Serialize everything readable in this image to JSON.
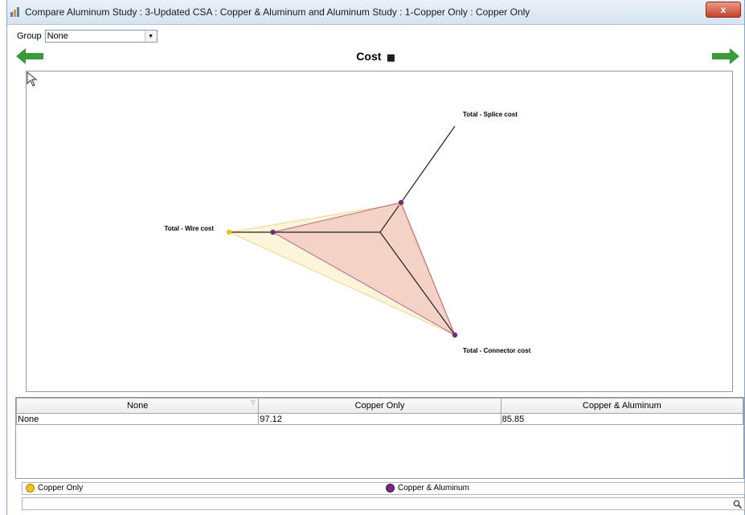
{
  "window": {
    "title": "Compare Aluminum Study : 3-Updated CSA : Copper & Aluminum and Aluminum Study : 1-Copper Only : Copper Only",
    "close_label": "x"
  },
  "group": {
    "label": "Group",
    "value": "None"
  },
  "chart": {
    "title": "Cost"
  },
  "chart_data": {
    "type": "radar",
    "title": "Cost",
    "axes": [
      "Total - Splice cost",
      "Total - Connector cost",
      "Total - Wire cost"
    ],
    "series": [
      {
        "name": "Copper Only",
        "color": "#f0c020",
        "values": [
          0.27,
          1.0,
          1.0
        ]
      },
      {
        "name": "Copper & Aluminum",
        "color": "#7b2a7b",
        "values": [
          0.28,
          1.0,
          0.71
        ]
      }
    ],
    "range": [
      0,
      1
    ],
    "legend_position": "bottom"
  },
  "table": {
    "columns": [
      "None",
      "Copper Only",
      "Copper & Aluminum"
    ],
    "rows": [
      [
        "None",
        "97.12",
        "85.85"
      ]
    ]
  },
  "legend": {
    "items": [
      {
        "label": "Copper Only",
        "color": "#f0c020"
      },
      {
        "label": "Copper & Aluminum",
        "color": "#7b2a7b"
      }
    ]
  },
  "search": {
    "value": "",
    "icon": "search-icon"
  }
}
